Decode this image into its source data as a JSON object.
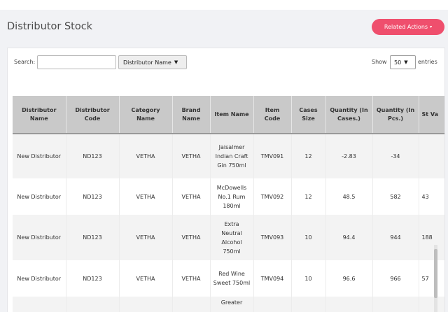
{
  "header": {
    "title": "Distributor Stock",
    "related_actions_label": "Related Actions",
    "related_actions_caret": "▾"
  },
  "filters": {
    "search_label": "Search:",
    "search_value": "",
    "filter_selected": "Distributor Name",
    "show_label": "Show",
    "entries_selected": "50",
    "entries_label": "entries"
  },
  "table": {
    "columns": [
      "Distributor Name",
      "Distributor Code",
      "Category Name",
      "Brand Name",
      "Item Name",
      "Item Code",
      "Cases Size",
      "Quantity (In Cases.)",
      "Quantity (In Pcs.)",
      "St Va"
    ],
    "rows": [
      [
        "New Distributor",
        "ND123",
        "VETHA",
        "VETHA",
        "Jaisalmer Indian Craft Gin 750ml",
        "TMV091",
        "12",
        "-2.83",
        "-34",
        ""
      ],
      [
        "New Distributor",
        "ND123",
        "VETHA",
        "VETHA",
        "McDowells No.1 Rum 180ml",
        "TMV092",
        "12",
        "48.5",
        "582",
        "43"
      ],
      [
        "New Distributor",
        "ND123",
        "VETHA",
        "VETHA",
        "Extra Neutral Alcohol 750ml",
        "TMV093",
        "10",
        "94.4",
        "944",
        "188"
      ],
      [
        "New Distributor",
        "ND123",
        "VETHA",
        "VETHA",
        "Red Wine Sweet 750ml",
        "TMV094",
        "10",
        "96.6",
        "966",
        "57"
      ],
      [
        "",
        "",
        "",
        "",
        "Greater",
        "",
        "",
        "",
        "",
        ""
      ]
    ]
  },
  "colors": {
    "accent": "#ef4f6d",
    "header_bg": "#c9c9c9"
  }
}
